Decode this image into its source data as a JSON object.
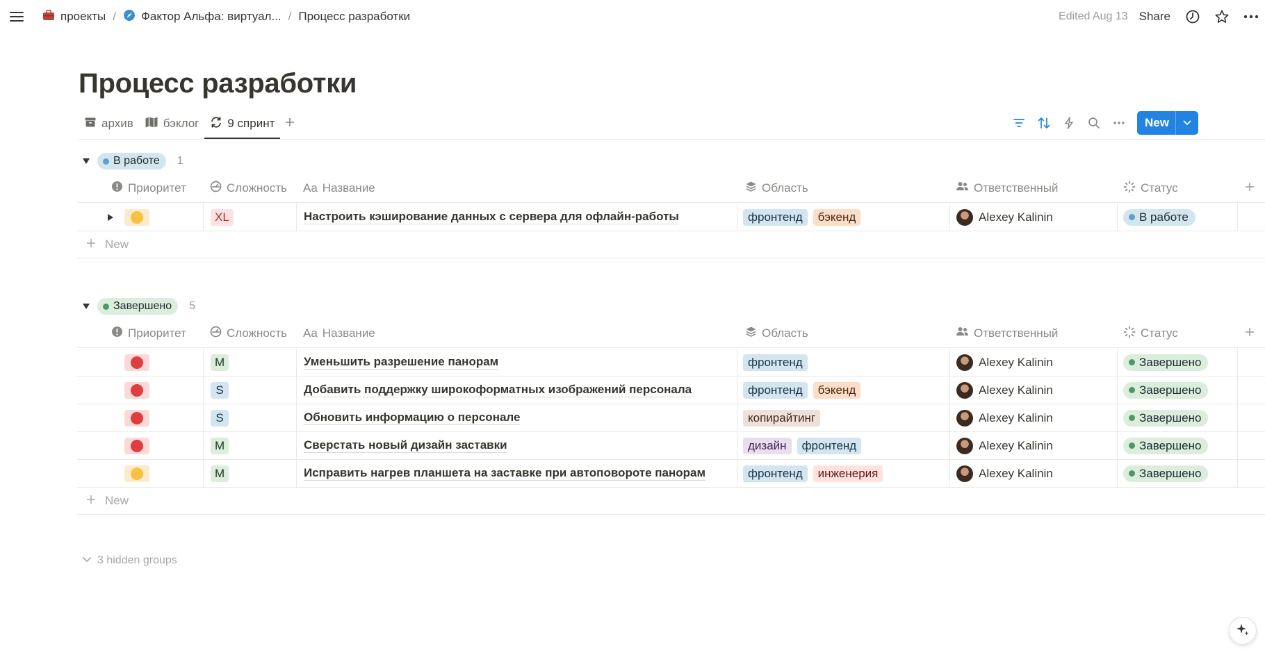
{
  "breadcrumb": {
    "items": [
      {
        "label": "проекты",
        "icon": "briefcase-icon"
      },
      {
        "label": "Фактор Альфа: виртуал...",
        "icon": "compass-icon"
      },
      {
        "label": "Процесс разработки"
      }
    ],
    "separator": "/"
  },
  "header": {
    "edited": "Edited Aug 13",
    "share": "Share"
  },
  "page": {
    "title": "Процесс разработки"
  },
  "tabs": [
    {
      "label": "архив",
      "icon": "archive-icon"
    },
    {
      "label": "бэклог",
      "icon": "map-icon"
    },
    {
      "label": "9 спринт",
      "icon": "refresh-icon",
      "active": true
    }
  ],
  "toolbar": {
    "new_label": "New"
  },
  "columns": {
    "priority": "Приоритет",
    "complexity": "Сложность",
    "name": "Название",
    "name_prefix": "Aa",
    "area": "Область",
    "responsible": "Ответственный",
    "status": "Статус"
  },
  "colors": {
    "accent": "#2383e2",
    "prio_yellow": "#f5c243",
    "prio_yellow_bg": "#fbeacb",
    "prio_red": "#e03e3e",
    "prio_red_bg": "#fcd9d9",
    "status_blue": "#5e9fd1",
    "status_blue_bg": "#d3e5ef",
    "status_green": "#4f9768",
    "status_green_bg": "#dbeddb"
  },
  "groups": [
    {
      "name": "В работе",
      "count": "1",
      "tone": "blue",
      "new_label": "New",
      "rows": [
        {
          "priority": "yellow",
          "complexity": "XL",
          "complexity_tone": "red",
          "name": "Настроить кэширование данных с сервера для офлайн-работы",
          "areas": [
            {
              "label": "фронтенд",
              "tone": "blue"
            },
            {
              "label": "бэкенд",
              "tone": "orange"
            }
          ],
          "responsible": "Alexey Kalinin",
          "status": "В работе",
          "status_tone": "blue",
          "expandable": true
        }
      ]
    },
    {
      "name": "Завершено",
      "count": "5",
      "tone": "green",
      "new_label": "New",
      "rows": [
        {
          "priority": "red",
          "complexity": "M",
          "complexity_tone": "green",
          "name": "Уменьшить разрешение панорам",
          "areas": [
            {
              "label": "фронтенд",
              "tone": "blue"
            }
          ],
          "responsible": "Alexey Kalinin",
          "status": "Завершено",
          "status_tone": "green"
        },
        {
          "priority": "red",
          "complexity": "S",
          "complexity_tone": "blue",
          "name": "Добавить поддержку широкоформатных изображений персонала",
          "areas": [
            {
              "label": "фронтенд",
              "tone": "blue"
            },
            {
              "label": "бэкенд",
              "tone": "orange"
            }
          ],
          "responsible": "Alexey Kalinin",
          "status": "Завершено",
          "status_tone": "green"
        },
        {
          "priority": "red",
          "complexity": "S",
          "complexity_tone": "blue",
          "name": "Обновить информацию о персонале",
          "areas": [
            {
              "label": "копирайтинг",
              "tone": "brown"
            }
          ],
          "responsible": "Alexey Kalinin",
          "status": "Завершено",
          "status_tone": "green"
        },
        {
          "priority": "red",
          "complexity": "M",
          "complexity_tone": "green",
          "name": "Сверстать новый дизайн заставки",
          "areas": [
            {
              "label": "дизайн",
              "tone": "purple"
            },
            {
              "label": "фронтенд",
              "tone": "blue"
            }
          ],
          "responsible": "Alexey Kalinin",
          "status": "Завершено",
          "status_tone": "green"
        },
        {
          "priority": "yellow",
          "complexity": "M",
          "complexity_tone": "green",
          "name": "Исправить нагрев планшета на заставке при автоповороте панорам",
          "areas": [
            {
              "label": "фронтенд",
              "tone": "blue"
            },
            {
              "label": "инженерия",
              "tone": "red"
            }
          ],
          "responsible": "Alexey Kalinin",
          "status": "Завершено",
          "status_tone": "green"
        }
      ]
    }
  ],
  "footer": {
    "hidden_groups": "3 hidden groups"
  }
}
